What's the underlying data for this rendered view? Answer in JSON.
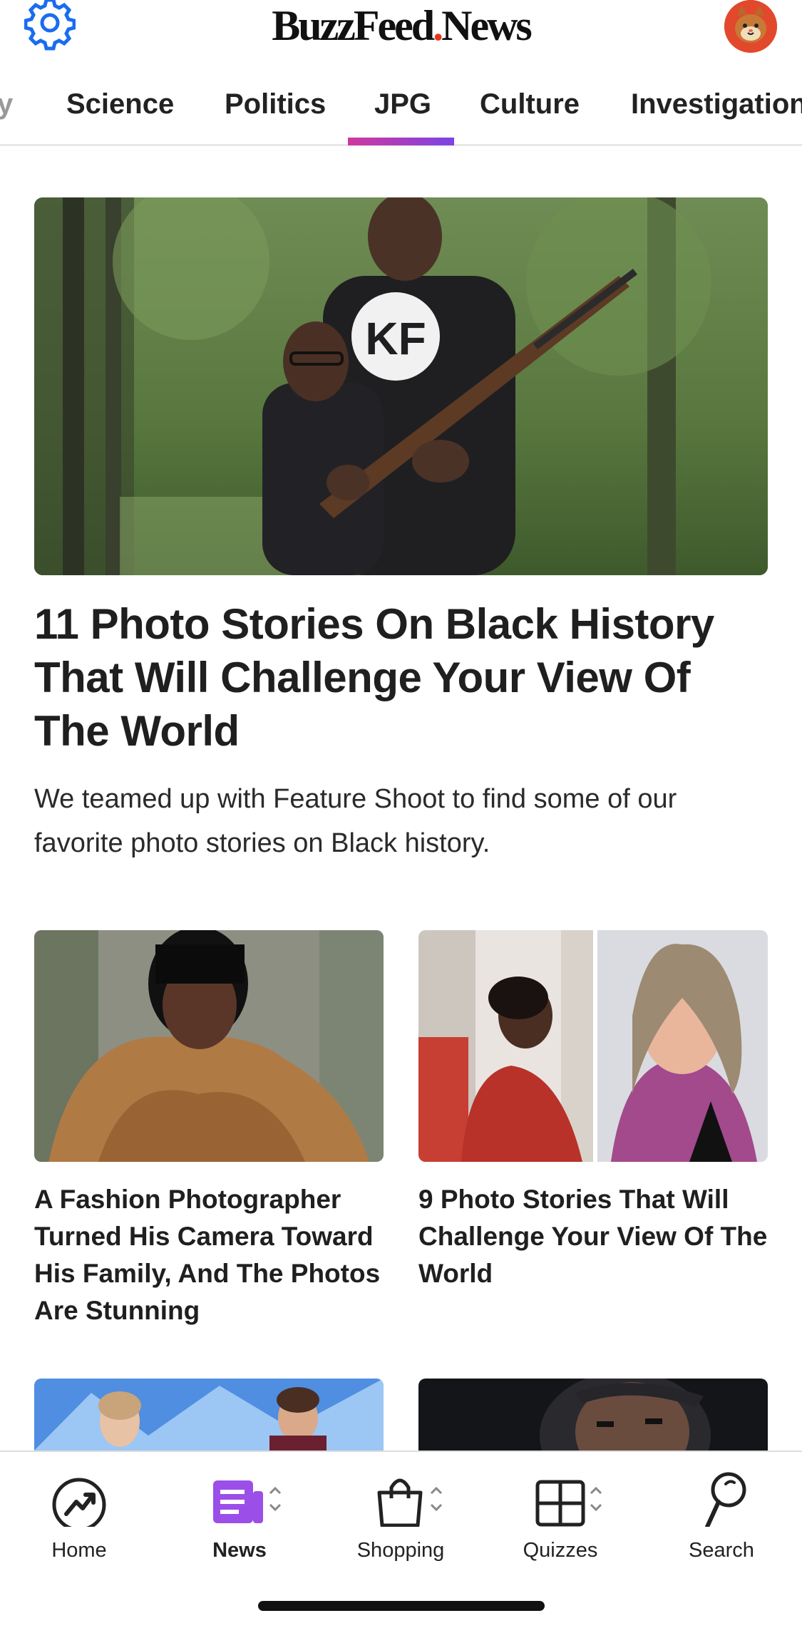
{
  "header": {
    "logo_left": "BuzzFeed",
    "logo_right": "News",
    "logo_dot": ".",
    "settings_icon": "gear-icon",
    "avatar_icon": "cat-avatar"
  },
  "tabs": [
    {
      "label": "y"
    },
    {
      "label": "Science"
    },
    {
      "label": "Politics"
    },
    {
      "label": "JPG",
      "active": true
    },
    {
      "label": "Culture"
    },
    {
      "label": "Investigation"
    }
  ],
  "hero": {
    "title": "11 Photo Stories On Black History That Will Challenge Your View Of The World",
    "description": "We teamed up with Feature Shoot to find some of our favorite photo stories on Black history.",
    "shirt_text": "KF"
  },
  "cards": [
    {
      "title": "A Fashion Photographer Turned His Camera Toward His Family, And The Photos Are Stunning"
    },
    {
      "title": "9 Photo Stories That Will Challenge Your View Of The World"
    }
  ],
  "bottom_nav": [
    {
      "label": "Home",
      "icon": "trending-icon"
    },
    {
      "label": "News",
      "icon": "news-icon",
      "active": true
    },
    {
      "label": "Shopping",
      "icon": "shopping-bag-icon"
    },
    {
      "label": "Quizzes",
      "icon": "quizzes-grid-icon"
    },
    {
      "label": "Search",
      "icon": "search-icon"
    }
  ],
  "colors": {
    "accent_blue": "#1a6cf0",
    "tab_gradient_start": "#d0389d",
    "tab_gradient_end": "#7c44e4",
    "news_purple": "#9b4fe8",
    "logo_dot_red": "#e7331c"
  }
}
